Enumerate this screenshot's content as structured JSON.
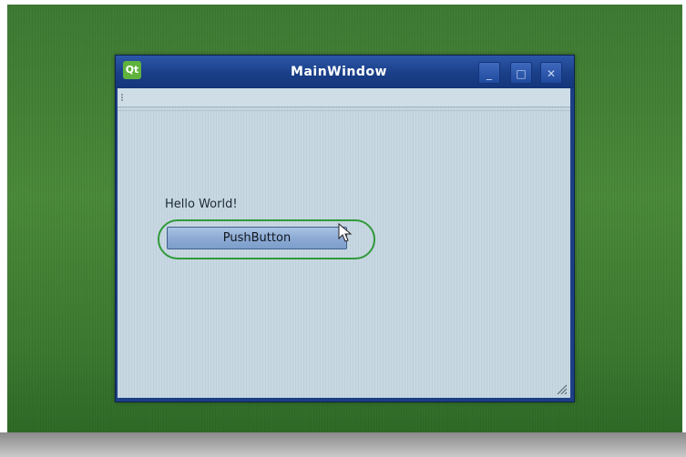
{
  "window": {
    "title": "MainWindow",
    "logo_text": "Qt",
    "controls": {
      "minimize": "_",
      "maximize": "□",
      "close": "✕"
    }
  },
  "content": {
    "label": "Hello World!",
    "button_label": "PushButton"
  },
  "colors": {
    "desktop": "#4a8a3a",
    "titlebar": "#1a3f88",
    "client": "#c8d8e2",
    "highlight_ring": "#2f9a3a"
  },
  "icons": [
    "qt-logo-icon",
    "minimize-icon",
    "maximize-icon",
    "close-icon",
    "mouse-cursor-icon",
    "resize-grip-icon"
  ]
}
